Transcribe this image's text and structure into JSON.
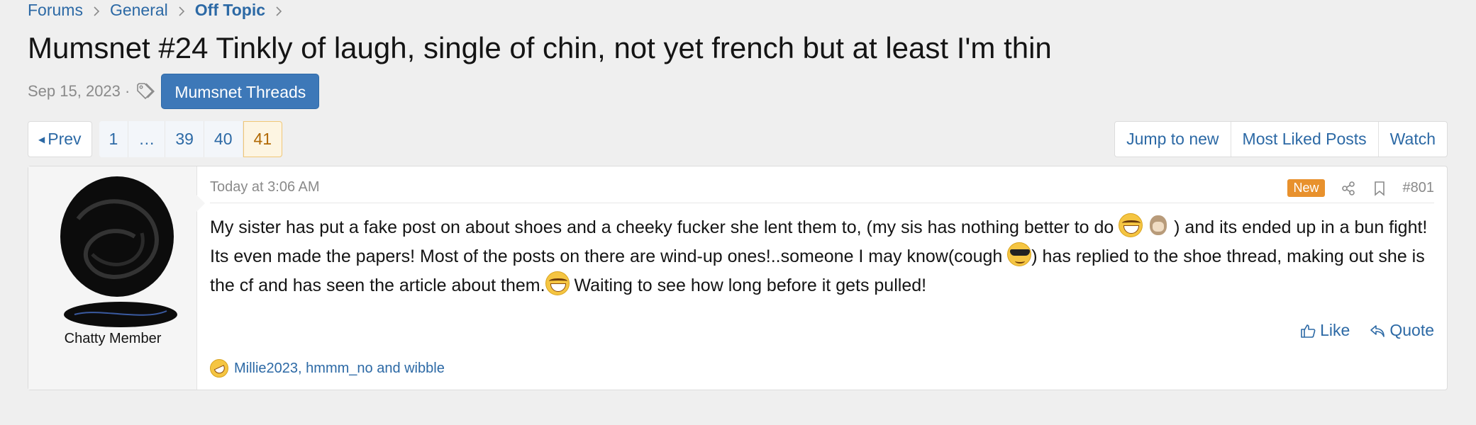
{
  "breadcrumb": [
    {
      "label": "Forums"
    },
    {
      "label": "General"
    },
    {
      "label": "Off Topic"
    }
  ],
  "thread": {
    "title": "Mumsnet #24 Tinkly of laugh, single of chin, not yet french but at least I'm thin",
    "date": "Sep 15, 2023 ·",
    "tag": "Mumsnet Threads"
  },
  "pagination": {
    "prev": "Prev",
    "first": "1",
    "ellipsis": "…",
    "pages": [
      "39",
      "40"
    ],
    "current": "41"
  },
  "actions": {
    "jump_new": "Jump to new",
    "most_liked": "Most Liked Posts",
    "watch": "Watch"
  },
  "post": {
    "user_title": "Chatty Member",
    "time": "Today at 3:06 AM",
    "new_badge": "New",
    "number": "#801",
    "body_1": "My sister has put a fake post on about shoes and a cheeky fucker she lent them to, (my sis has nothing better to do ",
    "body_2": " ) and its ended up in a bun fight! Its even made the papers! Most of the posts on there are wind-up ones!..someone I may know(cough ",
    "body_3": ") has replied to the shoe thread, making out she is the cf and has seen the article about them.",
    "body_4": " Waiting to see how long before it gets pulled!",
    "like": "Like",
    "quote": "Quote",
    "reactions": "Millie2023, hmmm_no and wibble"
  },
  "colors": {
    "link": "#2c69a5",
    "tag_bg": "#3d78b8",
    "new_badge": "#e8912d",
    "current_page": "#b26a04"
  }
}
